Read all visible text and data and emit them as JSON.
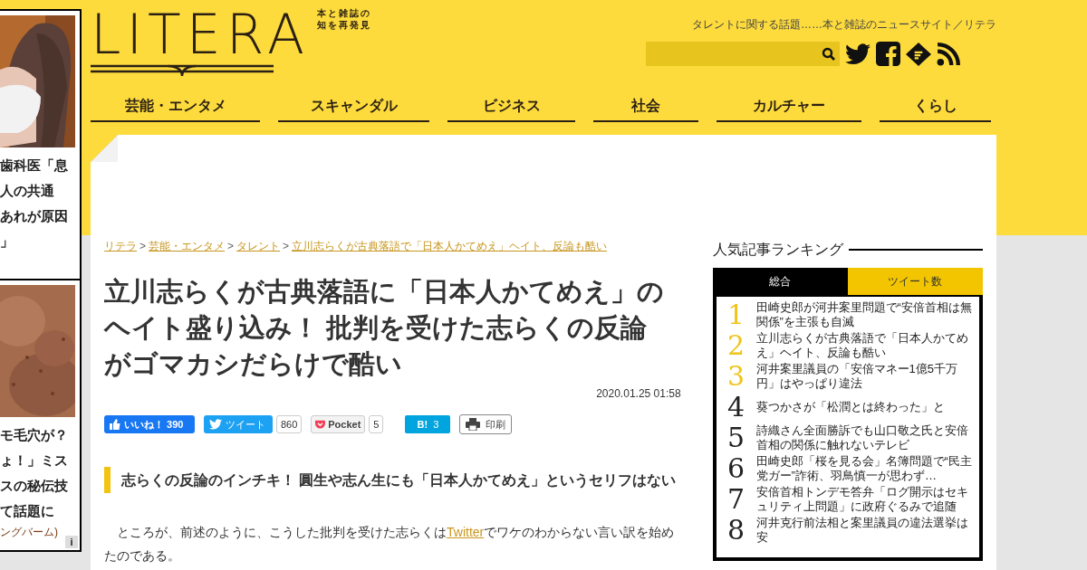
{
  "ad_column": {
    "items": [
      {
        "lines": [
          "歯科医「息",
          "人の共通",
          "あれが原因",
          "」"
        ]
      },
      {
        "lines": [
          "モ毛穴が？",
          "ょ！」ミス",
          "スの秘伝技",
          "て話題に"
        ],
        "source": "ングバーム)"
      }
    ],
    "info": "i"
  },
  "header": {
    "logo": "LITERA",
    "logo_sub": [
      "本と雑誌の",
      "知を再発見"
    ],
    "tagline": "タレントに関する話題……本と雑誌のニュースサイト／リテラ"
  },
  "nav": [
    "芸能・エンタメ",
    "スキャンダル",
    "ビジネス",
    "社会",
    "カルチャー",
    "くらし"
  ],
  "breadcrumb": [
    {
      "label": "リテラ"
    },
    {
      "separator": ">",
      "label": "芸能・エンタメ"
    },
    {
      "separator": ">",
      "label": "タレント"
    },
    {
      "separator": ">",
      "label": "立川志らくが古典落語で「日本人かてめえ」ヘイト、反論も酷い"
    }
  ],
  "article": {
    "title": "立川志らくが古典落語に「日本人かてめえ」のヘイト盛り込み！ 批判を受けた志らくの反論がゴマカシだらけで酷い",
    "date": "2020.01.25 01:58",
    "share": [
      {
        "kind": "facebook",
        "label": "いいね！ 390"
      },
      {
        "kind": "twitter",
        "label": "ツイート",
        "count": "860"
      },
      {
        "kind": "pocket",
        "label": "Pocket",
        "count": "5"
      },
      {
        "kind": "hatena",
        "label": "B!",
        "count": "3"
      },
      {
        "kind": "print",
        "label": "印刷"
      }
    ],
    "heading": "志らくの反論のインチキ！ 圓生や志ん生にも「日本人かてめえ」というセリフはない",
    "paragraph": {
      "before": "　ところが、前述のように、こうした批判を受けた志らくは",
      "link": "Twitter",
      "after": "でワケのわからない言い訳を始めたのである。"
    }
  },
  "ranking": {
    "title": "人気記事ランキング",
    "tabs": [
      {
        "label": "総合",
        "selected": true
      },
      {
        "label": "ツイート数",
        "selected": false
      }
    ],
    "items": [
      {
        "rank": "1",
        "color": "#f0c419",
        "title": "田崎史郎が河井案里問題で“安倍首相は無関係”を主張も自滅"
      },
      {
        "rank": "2",
        "color": "#f0c419",
        "title": "立川志らくが古典落語で「日本人かてめえ」ヘイト、反論も酷い"
      },
      {
        "rank": "3",
        "color": "#f0c419",
        "title": "河井案里議員の「安倍マネー1億5千万円」はやっぱり違法"
      },
      {
        "rank": "4",
        "color": "#222222",
        "title": "葵つかさが「松潤とは終わった」と"
      },
      {
        "rank": "5",
        "color": "#222222",
        "title": "詩織さん全面勝訴でも山口敬之氏と安倍首相の関係に触れないテレビ"
      },
      {
        "rank": "6",
        "color": "#222222",
        "title": "田崎史郎「桜を見る会」名簿問題で“民主党ガー”詐術、羽鳥慎一が思わず…"
      },
      {
        "rank": "7",
        "color": "#222222",
        "title": "安倍首相トンデモ答弁「ログ開示はセキュリティ上問題」に政府ぐるみで追随"
      },
      {
        "rank": "8",
        "color": "#222222",
        "title": "河井克行前法相と案里議員の違法選挙は安"
      }
    ]
  }
}
